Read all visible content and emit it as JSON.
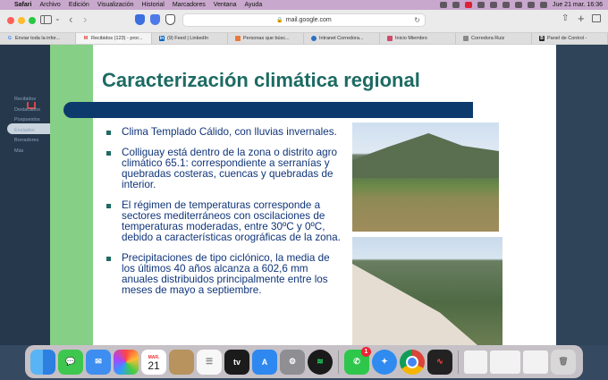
{
  "menubar": {
    "apple": "",
    "items": [
      "Safari",
      "Archivo",
      "Edición",
      "Visualización",
      "Historial",
      "Marcadores",
      "Ventana",
      "Ayuda"
    ],
    "clock": "Jue 21 mar.  16:36"
  },
  "toolbar": {
    "url": "mail.google.com",
    "back": "‹",
    "forward": "›",
    "sidebar_chevron": "⌄",
    "reload": "↻",
    "share": "⇧",
    "new_tab": "+"
  },
  "tabs": [
    {
      "label": "Enviar toda la infor...",
      "favicon": "google-icon",
      "color": "#4285f4",
      "letter": "G"
    },
    {
      "label": "Recibidos (123) - pror...",
      "favicon": "gmail-icon",
      "color": "#d93025",
      "letter": "M"
    },
    {
      "label": "(9) Feed | LinkedIn",
      "favicon": "linkedin-icon",
      "color": "#0a66c2",
      "letter": "in"
    },
    {
      "label": "Personas que búsc...",
      "favicon": "page-icon",
      "color": "#e8793a",
      "letter": ""
    },
    {
      "label": "Intranet Corredora...",
      "favicon": "intranet-icon",
      "color": "#2d6fc1",
      "letter": ""
    },
    {
      "label": "Inicio Miembro",
      "favicon": "member-icon",
      "color": "#d04a6a",
      "letter": ""
    },
    {
      "label": "Corredora Ruiz",
      "favicon": "ruiz-icon",
      "color": "#888888",
      "letter": ""
    },
    {
      "label": "Panel de Control -",
      "favicon": "panel-icon",
      "color": "#222222",
      "letter": "B"
    }
  ],
  "slide": {
    "title": "Caracterización climática regional",
    "bullets": [
      "Clima Templado Cálido, con lluvias invernales.",
      "Colliguay está dentro de la zona o distrito agro climático 65.1: correspondiente a serranías y quebradas costeras, cuencas y quebradas de interior.",
      "El régimen de temperaturas corresponde a sectores mediterráneos con oscilaciones de temperaturas moderadas, entre 30ºC y 0ºC, debido a características orográficas de la zona.",
      "Precipitaciones de tipo ciclónico, la media de los últimos 40 años alcanza a 602,6 mm anuales distribuidos principalmente entre los meses de mayo a septiembre."
    ]
  },
  "gmail_background": {
    "sidebar_items": [
      "Recibidos",
      "Destacados",
      "Pospuestos",
      "Enviados",
      "Borradores",
      "Más"
    ]
  },
  "dock": {
    "calendar_month": "MAR.",
    "calendar_day": "21",
    "appletv_label": "tv",
    "whatsapp_badge": "1",
    "apps": [
      {
        "name": "finder-icon",
        "color": "#3a8ee6"
      },
      {
        "name": "messages-icon",
        "color": "#3ec74f"
      },
      {
        "name": "mail-icon",
        "color": "#3d8ef0"
      },
      {
        "name": "photos-icon",
        "color": "#f4f4f4"
      },
      {
        "name": "calendar-icon",
        "color": "#ffffff"
      },
      {
        "name": "contacts-icon",
        "color": "#b8935e"
      },
      {
        "name": "reminders-icon",
        "color": "#f7f7f7"
      },
      {
        "name": "appletv-icon",
        "color": "#1b1b1b"
      },
      {
        "name": "appstore-icon",
        "color": "#2f88f0"
      },
      {
        "name": "settings-icon",
        "color": "#8e8e93"
      },
      {
        "name": "spotify-icon",
        "color": "#1a1a1a"
      },
      {
        "name": "whatsapp-icon",
        "color": "#2fc64c"
      },
      {
        "name": "safari-icon",
        "color": "#2f8bf0"
      },
      {
        "name": "chrome-icon",
        "color": "#ffffff"
      },
      {
        "name": "voicememos-icon",
        "color": "#222222"
      }
    ]
  }
}
